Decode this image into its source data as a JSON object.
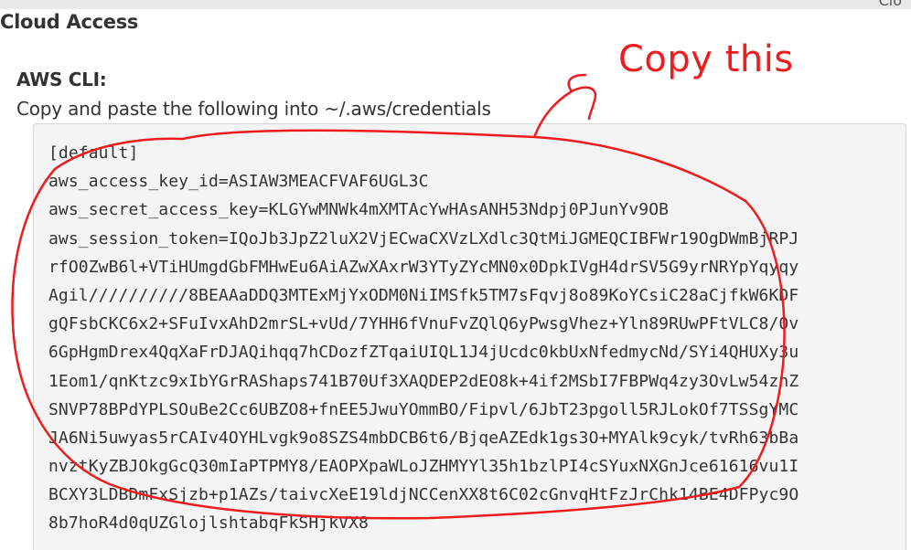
{
  "top_bar": {
    "corner_text": "Clo"
  },
  "section": {
    "title": "Cloud Access"
  },
  "aws_cli": {
    "heading": "AWS CLI:",
    "instructions": "Copy and paste the following into ~/.aws/credentials",
    "credentials_lines": [
      "[default]",
      "aws_access_key_id=ASIAW3MEACFVAF6UGL3C",
      "aws_secret_access_key=KLGYwMNWk4mXMTAcYwHAsANH53Ndpj0PJunYv9OB",
      "aws_session_token=IQoJb3JpZ2luX2VjECwaCXVzLXdlc3QtMiJGMEQCIBFWr19OgDWmBjRPJ",
      "rfO0ZwB6l+VTiHUmgdGbFMHwEu6AiAZwXAxrW3YTyZYcMN0x0DpkIVgH4drSV5G9yrNRYpYqyqy",
      "Agil//////////8BEAAaDDQ3MTExMjYxODM0NiIMSfk5TM7sFqvj8o89KoYCsiC28aCjfkW6KDF",
      "gQFsbCKC6x2+SFuIvxAhD2mrSL+vUd/7YHH6fVnuFvZQlQ6yPwsgVhez+Yln89RUwPFtVLC8/0v",
      "6GpHgmDrex4QqXaFrDJAQihqq7hCDozfZTqaiUIQL1J4jUcdc0kbUxNfedmycNd/SYi4QHUXy3u",
      "1Eom1/qnKtzc9xIbYGrRAShaps741B70Uf3XAQDEP2dEO8k+4if2MSbI7FBPWq4zy3OvLw54znZ",
      "SNVP78BPdYPLSOuBe2Cc6UBZO8+fnEE5JwuYOmmBO/Fipvl/6JbT23pgoll5RJLokOf7TSSgYMC",
      "JA6Ni5uwyas5rCAIv4OYHLvgk9o8SZS4mbDCB6t6/BjqeAZEdk1gs3O+MYAlk9cyk/tvRh63bBa",
      "nvztKyZBJOkgGcQ30mIaPTPMY8/EAOPXpaWLoJZHMYYl35h1bzlPI4cSYuxNXGnJce61616vu1I",
      "BCXY3LDBDmFxSjzb+p1AZs/taivcXeE19ldjNCCenXX8t6C02cGnvqHtFzJrChk14BE4DFPyc9O",
      "8b7hoR4d0qUZGlojlshtabqFkSHjkVX8"
    ]
  },
  "annotation": {
    "label": "Copy this",
    "color": "#ee1c1c"
  }
}
